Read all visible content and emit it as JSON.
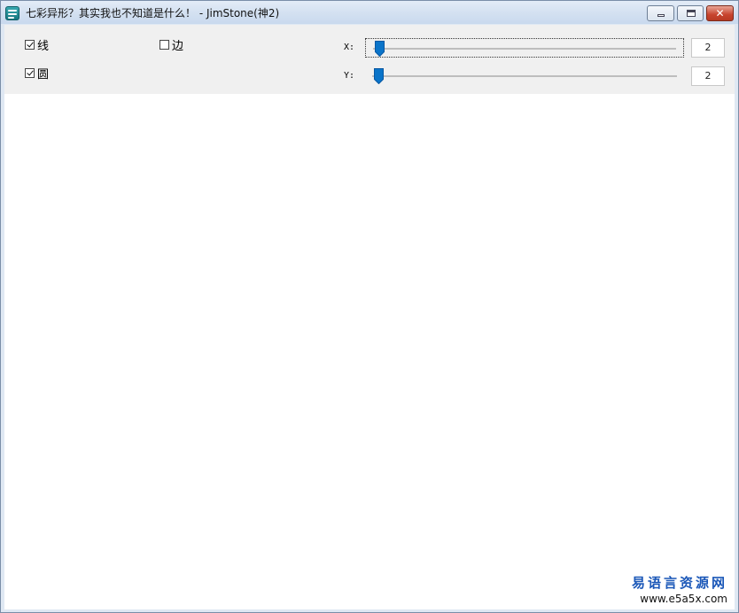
{
  "window": {
    "title": "七彩异形？其实我也不知道是什么！ - JimStone(神2)",
    "controls": {
      "minimize": "minimize-icon",
      "maximize": "maximize-icon",
      "close": "close-icon",
      "close_glyph": "✕"
    }
  },
  "options": {
    "line_label": "线",
    "line_checked": true,
    "edge_label": "边",
    "edge_checked": false,
    "circle_label": "圆",
    "circle_checked": true
  },
  "sliders": {
    "x": {
      "label": "X:",
      "value": "2",
      "position_fraction": 0.0
    },
    "y": {
      "label": "Y:",
      "value": "2",
      "position_fraction": 0.0
    }
  },
  "watermark": {
    "name": "易语言资源网",
    "url": "www.e5a5x.com"
  },
  "colors": {
    "accent": "#0a74c9",
    "titlebar": "#d4e1f1",
    "close": "#c7442e",
    "panel": "#f0f0f0"
  }
}
